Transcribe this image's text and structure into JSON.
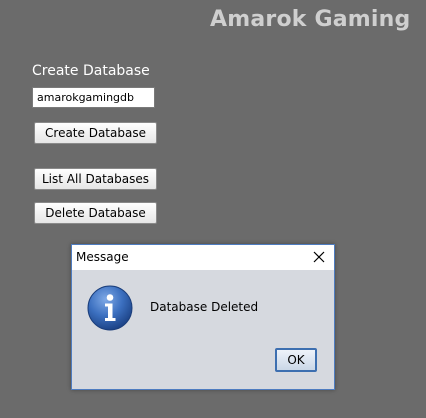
{
  "app": {
    "title": "Amarok Gaming",
    "background_color": "#6b6b6b"
  },
  "create_section": {
    "label": "Create Database",
    "database_name_value": "amarokgamingdb",
    "create_button_label": "Create Database"
  },
  "actions": {
    "list_button_label": "List All Databases",
    "delete_button_label": "Delete Database"
  },
  "dialog": {
    "title": "Message",
    "message": "Database Deleted",
    "icon": "info-icon",
    "ok_label": "OK",
    "close_icon": "close-icon"
  }
}
